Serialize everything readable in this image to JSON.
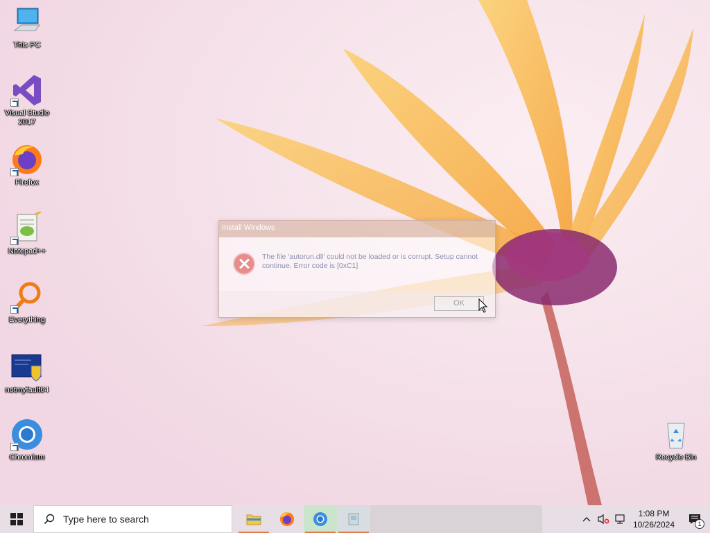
{
  "desktop": {
    "icons": [
      {
        "label": "This PC",
        "icon": "computer-icon"
      },
      {
        "label": "Visual Studio 2017",
        "icon": "visual-studio-icon"
      },
      {
        "label": "Firefox",
        "icon": "firefox-icon"
      },
      {
        "label": "Notepad++",
        "icon": "notepadpp-icon"
      },
      {
        "label": "Everything",
        "icon": "everything-search-icon"
      },
      {
        "label": "notmyfault64",
        "icon": "notmyfault-icon"
      },
      {
        "label": "Chromium",
        "icon": "chromium-icon"
      },
      {
        "label": "Recycle Bin",
        "icon": "recycle-bin-icon"
      }
    ]
  },
  "dialog": {
    "title": "Install Windows",
    "message": "The file 'autorun.dll' could not be loaded or is corrupt. Setup cannot continue. Error code is [0xC1]",
    "ok_label": "OK",
    "icon": "error-icon"
  },
  "taskbar": {
    "search_placeholder": "Type here to search",
    "apps": [
      "file-explorer-icon",
      "firefox-icon",
      "chromium-icon",
      "setup-icon"
    ],
    "clock_time": "1:08 PM",
    "clock_date": "10/26/2024",
    "notification_count": "1"
  },
  "colors": {
    "accent": "#e07a4b",
    "taskbar": "#e8dfe6",
    "error": "#e58c8c"
  }
}
